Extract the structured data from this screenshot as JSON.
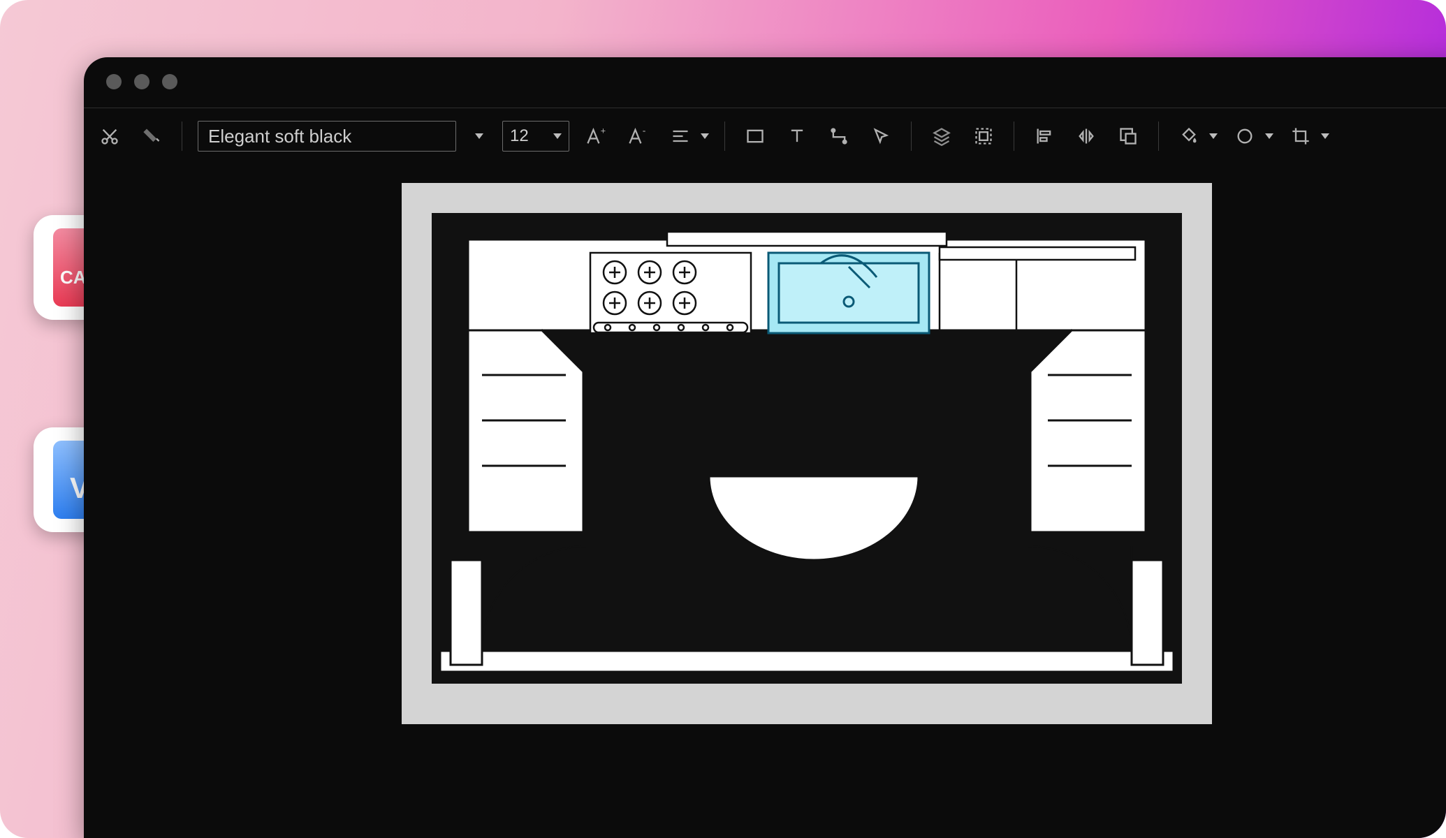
{
  "window": {
    "traffic_lights": 3
  },
  "toolbar": {
    "theme_name": "Elegant soft black",
    "font_size": "12"
  },
  "chips": {
    "cad_label": "CAD",
    "visio_label": "V"
  },
  "canvas": {
    "description": "Kitchen floor plan with U-shaped counter, 6-burner cooktop, highlighted sink, semi-circular table, and two door swings"
  }
}
